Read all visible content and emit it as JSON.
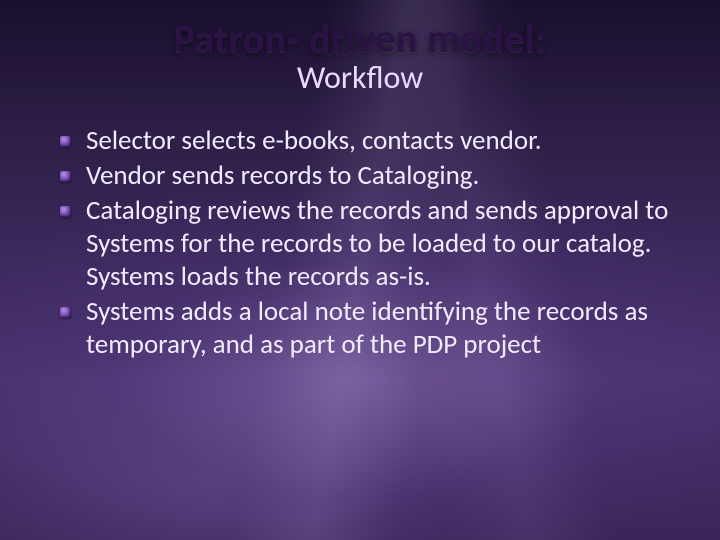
{
  "title": "Patron- driven model:",
  "subtitle": "Workflow",
  "bullets": [
    "Selector selects e-books, contacts vendor.",
    "Vendor sends records to Cataloging.",
    "Cataloging reviews the records and sends approval to Systems for the records to be loaded to our catalog. Systems loads the records as-is.",
    "Systems adds a local note identifying the records as temporary, and as part of the PDP project"
  ]
}
